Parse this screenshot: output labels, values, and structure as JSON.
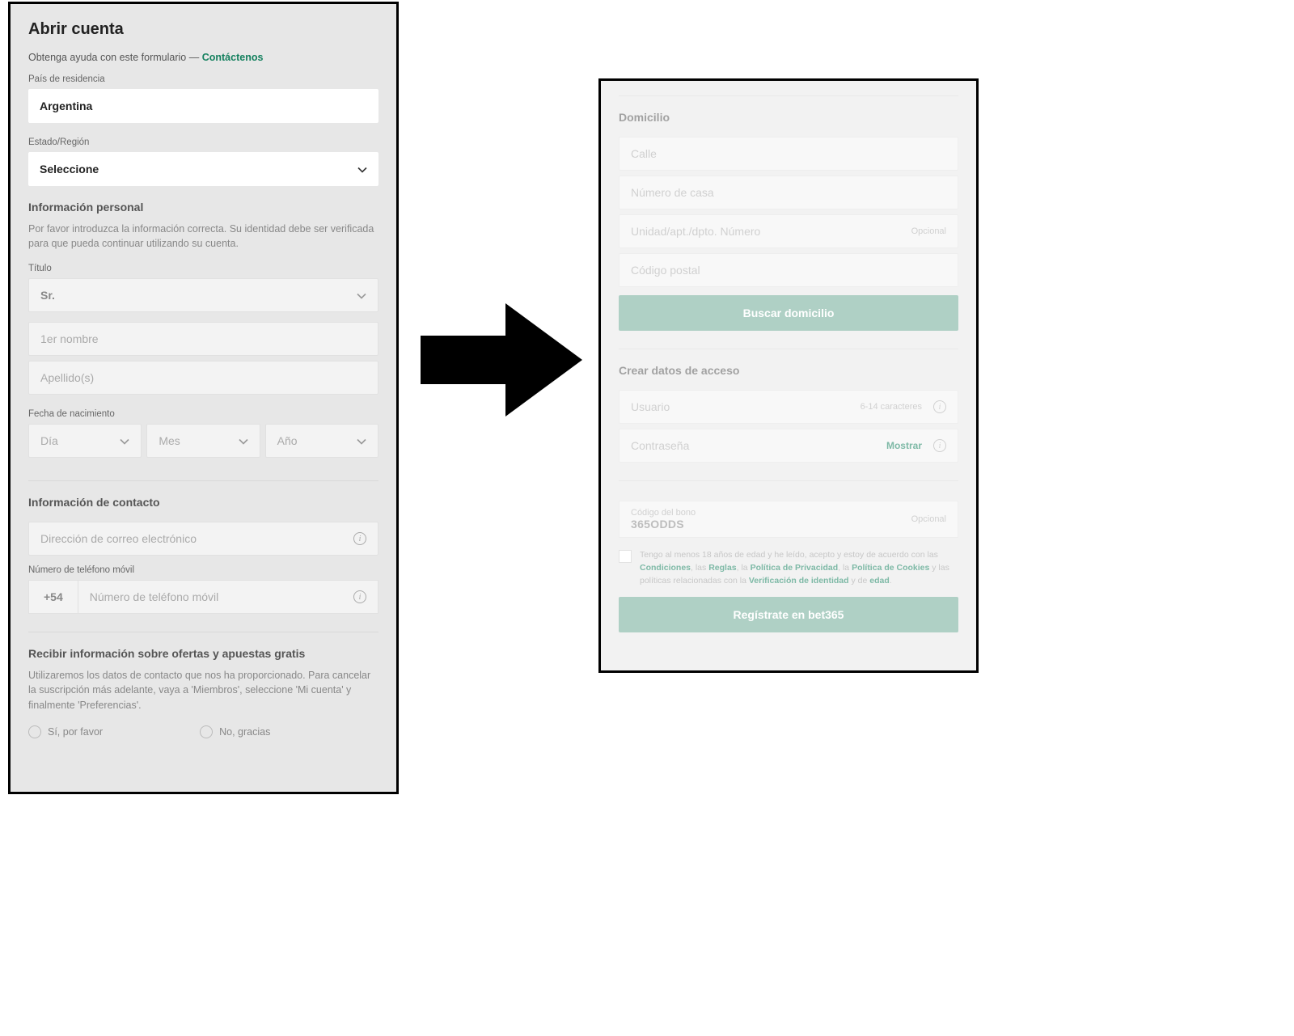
{
  "left": {
    "title": "Abrir cuenta",
    "help_prefix": "Obtenga ayuda con este formulario — ",
    "help_link": "Contáctenos",
    "country_label": "País de residencia",
    "country_value": "Argentina",
    "state_label": "Estado/Región",
    "state_value": "Seleccione",
    "personal": {
      "heading": "Información personal",
      "desc": "Por favor introduzca la información correcta. Su identidad debe ser verificada para que pueda continuar utilizando su cuenta.",
      "title_label": "Título",
      "title_value": "Sr.",
      "firstname_ph": "1er nombre",
      "lastname_ph": "Apellido(s)",
      "dob_label": "Fecha de nacimiento",
      "day": "Día",
      "month": "Mes",
      "year": "Año"
    },
    "contact": {
      "heading": "Información de contacto",
      "email_ph": "Dirección de correo electrónico",
      "phone_label": "Número de teléfono móvil",
      "phone_prefix": "+54",
      "phone_ph": "Número de teléfono móvil"
    },
    "offers": {
      "heading": "Recibir información sobre ofertas y apuestas gratis",
      "desc": "Utilizaremos los datos de contacto que nos ha proporcionado. Para cancelar la suscripción más adelante, vaya a 'Miembros', seleccione 'Mi cuenta' y finalmente 'Preferencias'.",
      "yes": "Sí, por favor",
      "no": "No, gracias"
    }
  },
  "right": {
    "address": {
      "heading": "Domicilio",
      "street_ph": "Calle",
      "number_ph": "Número de casa",
      "unit_ph": "Unidad/apt./dpto. Número",
      "postal_ph": "Código postal",
      "opcional": "Opcional",
      "find_btn": "Buscar domicilio"
    },
    "access": {
      "heading": "Crear datos de acceso",
      "user_ph": "Usuario",
      "user_hint": "6-14 caracteres",
      "pass_ph": "Contraseña",
      "show": "Mostrar"
    },
    "bonus": {
      "label": "Código del bono",
      "value": "365ODDS",
      "opcional": "Opcional"
    },
    "terms": {
      "t1": "Tengo al menos 18 años de edad y he leído, acepto y estoy de acuerdo con las ",
      "conditions": "Condiciones",
      "t2": ", las ",
      "rules": "Reglas",
      "t3": ", la ",
      "privacy": "Política de Privacidad",
      "t4": ", la ",
      "cookies": "Política de Cookies",
      "t5": " y las políticas relacionadas con la ",
      "identity": "Verificación de identidad",
      "t6": " y de ",
      "age": "edad",
      "t7": "."
    },
    "register_btn": "Regístrate en bet365"
  }
}
